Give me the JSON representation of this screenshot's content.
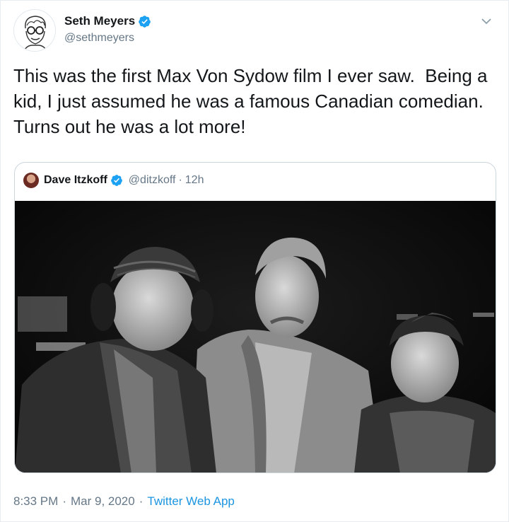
{
  "author": {
    "display_name": "Seth Meyers",
    "handle": "@sethmeyers",
    "verified": true
  },
  "tweet": {
    "text": "This was the first Max Von Sydow film I ever saw.  Being a kid, I just assumed he was a famous Canadian comedian. Turns out he was a lot more!"
  },
  "quoted_tweet": {
    "display_name": "Dave Itzkoff",
    "handle": "@ditzkoff",
    "time_sep": "·",
    "time": "12h",
    "verified": true
  },
  "footer": {
    "time": "8:33 PM",
    "sep1": "·",
    "date": "Mar 9, 2020",
    "sep2": "·",
    "source": "Twitter Web App"
  },
  "colors": {
    "verified_blue": "#1da1f2",
    "link_blue": "#1b95e0",
    "secondary_text": "#657786"
  },
  "icons": {
    "verified": "verified-badge-icon",
    "caret": "chevron-down-icon"
  }
}
